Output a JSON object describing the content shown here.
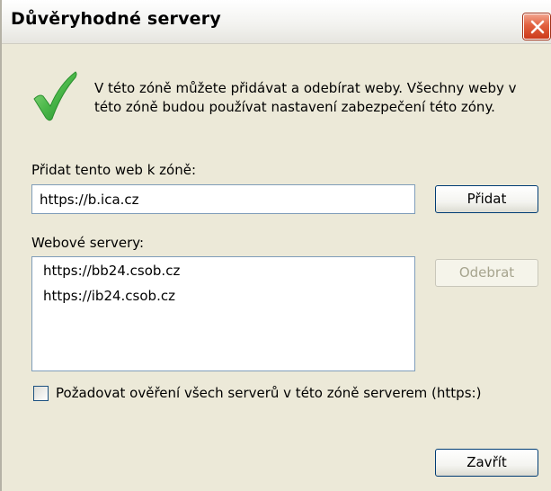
{
  "window": {
    "title": "Důvěryhodné servery"
  },
  "intro_text": "V této zóně můžete přidávat a odebírat weby. Všechny weby v této zóně budou používat nastavení zabezpečení této zóny.",
  "add_site": {
    "label": "Přidat tento web k zóně:",
    "value": "https://b.ica.cz",
    "button_label": "Přidat"
  },
  "websites": {
    "label": "Webové servery:",
    "items": [
      "https://bb24.csob.cz",
      "https://ib24.csob.cz"
    ],
    "remove_label": "Odebrat"
  },
  "require_https": {
    "label": "Požadovat ověření všech serverů v této zóně serverem (https:)",
    "checked": false
  },
  "close_label": "Zavřít",
  "icons": {
    "close": "close-icon",
    "check": "checkmark-icon"
  },
  "colors": {
    "dialog_bg": "#ece9d8",
    "close_button": "#e2613f",
    "check_green": "#4cb84a",
    "input_border": "#7f9db9",
    "button_border": "#003c74"
  }
}
